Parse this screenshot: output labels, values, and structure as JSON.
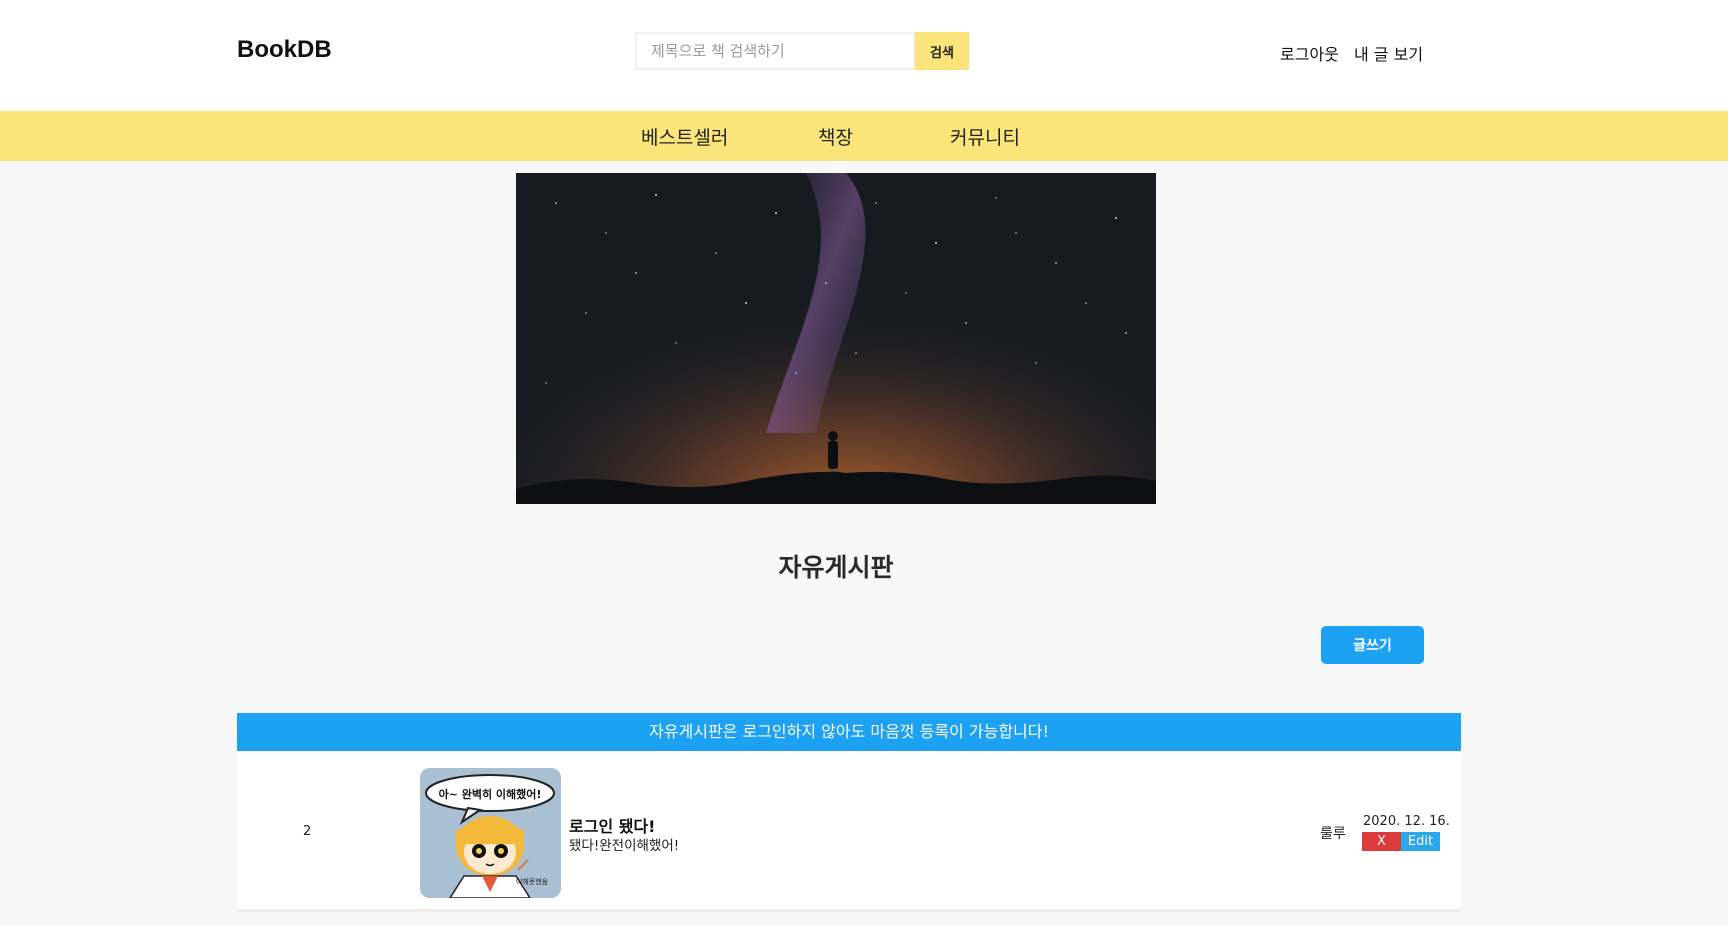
{
  "header": {
    "brand": "BookDB",
    "search_placeholder": "제목으로 책 검색하기",
    "search_button": "검색",
    "logout": "로그아웃",
    "my_posts": "내 글 보기"
  },
  "nav": {
    "items": [
      {
        "label": "베스트셀러"
      },
      {
        "label": "책장"
      },
      {
        "label": "커뮤니티"
      }
    ]
  },
  "board": {
    "title": "자유게시판",
    "write_button": "글쓰기",
    "notice": "자유게시판은 로그인하지 않아도 마음껏 등록이 가능합니다!"
  },
  "posts": [
    {
      "number": "2",
      "title": "로그인 됐다!",
      "body": "됐다!완전이해했어!",
      "author": "룰루",
      "date": "2020. 12. 16.",
      "delete_label": "X",
      "edit_label": "Edit",
      "thumb_speech": "아~ 완벽히 이해했어!",
      "thumb_caption": "이해못했음"
    }
  ],
  "colors": {
    "nav_bg": "#fae57a",
    "accent_blue": "#1da1f2",
    "delete_red": "#dc3b3b"
  }
}
